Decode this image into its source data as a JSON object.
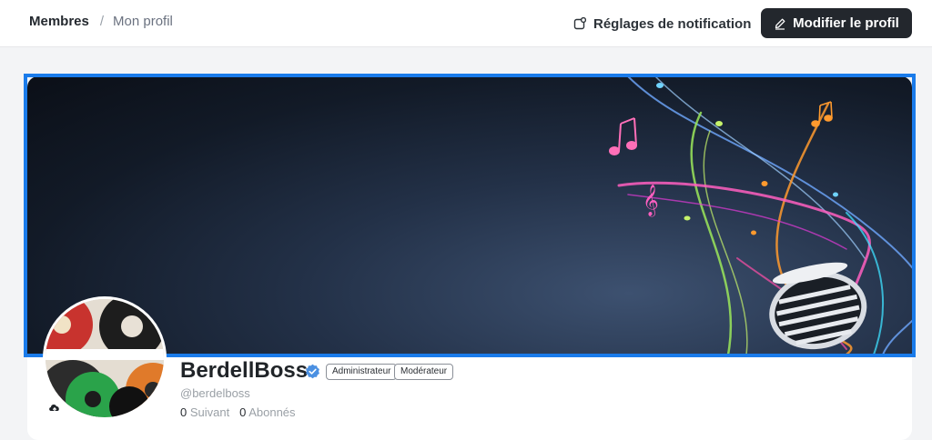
{
  "header": {
    "breadcrumb_root": "Membres",
    "breadcrumb_separator": "/",
    "breadcrumb_current": "Mon profil",
    "notification_settings_label": "Réglages de notification",
    "edit_profile_label": "Modifier le profil"
  },
  "profile": {
    "display_name": "BerdellBoss",
    "verified": true,
    "roles": [
      "Administrateur",
      "Modérateur"
    ],
    "handle": "@berdelboss",
    "following_count": "0",
    "following_label": "Suivant",
    "followers_count": "0",
    "followers_label": "Abonnés"
  },
  "banner": {
    "image": "music-notes-microphone-dark-banner",
    "selected": true
  },
  "colors": {
    "selection_outline": "#1a7bea",
    "primary_button": "#23272d",
    "verified_badge": "#4a90e2"
  }
}
